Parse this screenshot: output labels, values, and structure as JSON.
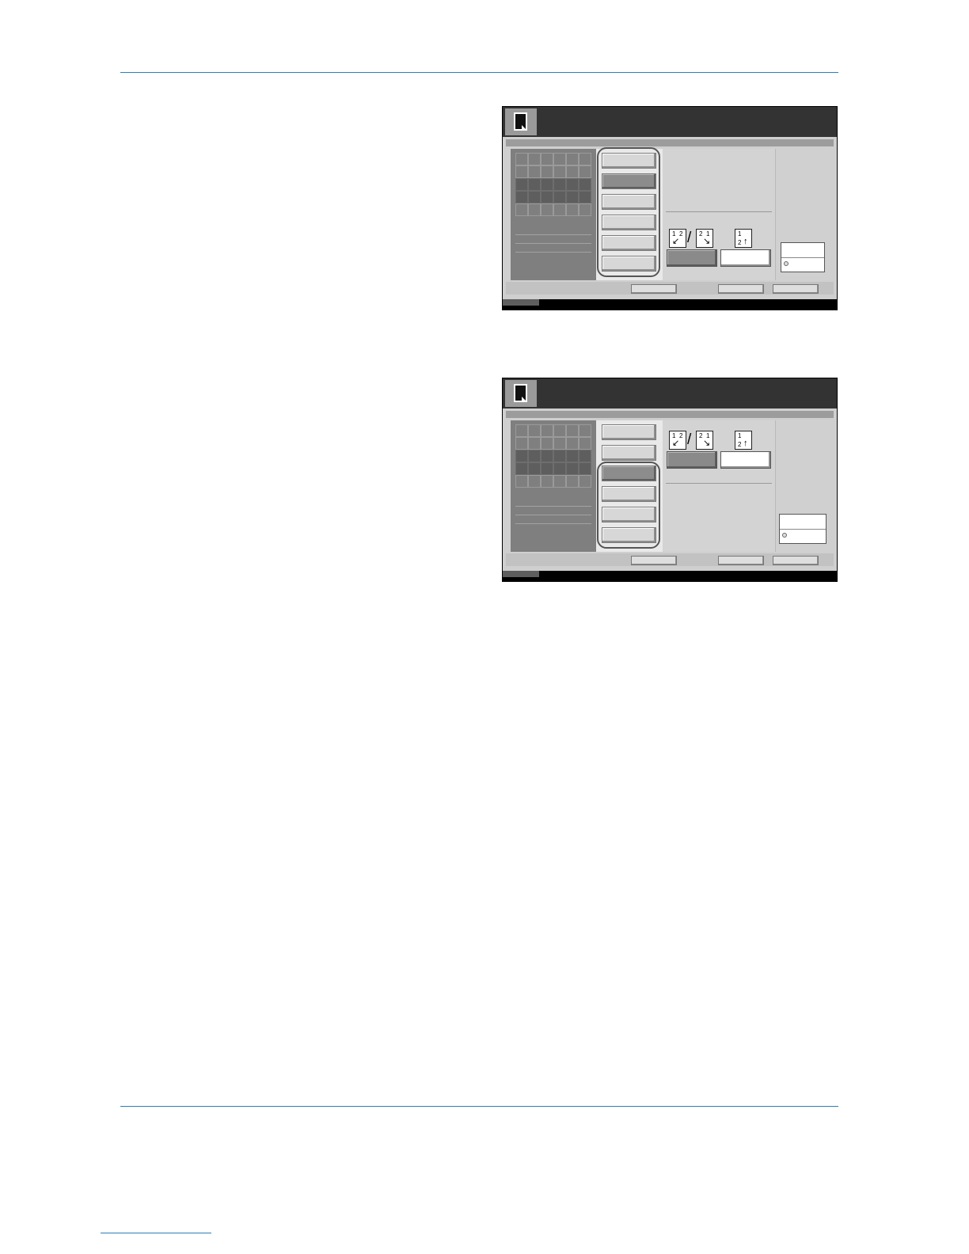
{
  "page": {
    "rule_color": "#2d7fb5"
  },
  "screens": [
    {
      "screen_title": "",
      "thumbnail_grid": {
        "rows": 5,
        "cols": 6,
        "dark_rows": [
          2,
          3
        ]
      },
      "side_buttons": [
        {
          "label": "",
          "state": "normal"
        },
        {
          "label": "",
          "state": "active"
        },
        {
          "label": "",
          "state": "normal"
        },
        {
          "label": "",
          "state": "normal"
        },
        {
          "label": "",
          "state": "normal"
        },
        {
          "label": "",
          "state": "normal"
        }
      ],
      "highlighted_button_range": "1-6",
      "binding_icons": [
        "left-binding-icon",
        "right-binding-icon",
        "top-binding-icon"
      ],
      "options": [
        {
          "label": "",
          "state": "selected"
        },
        {
          "label": "",
          "state": "unselected"
        }
      ],
      "bottom_buttons": [
        "",
        "",
        ""
      ]
    },
    {
      "screen_title": "",
      "thumbnail_grid": {
        "rows": 5,
        "cols": 6,
        "dark_rows": [
          2,
          3
        ]
      },
      "side_buttons": [
        {
          "label": "",
          "state": "normal"
        },
        {
          "label": "",
          "state": "normal"
        },
        {
          "label": "",
          "state": "active"
        },
        {
          "label": "",
          "state": "normal"
        },
        {
          "label": "",
          "state": "normal"
        },
        {
          "label": "",
          "state": "normal"
        }
      ],
      "highlighted_button_range": "3-6",
      "binding_icons": [
        "left-binding-icon",
        "right-binding-icon",
        "top-binding-icon"
      ],
      "options": [
        {
          "label": "",
          "state": "selected"
        },
        {
          "label": "",
          "state": "unselected"
        }
      ],
      "bottom_buttons": [
        "",
        "",
        ""
      ]
    }
  ]
}
